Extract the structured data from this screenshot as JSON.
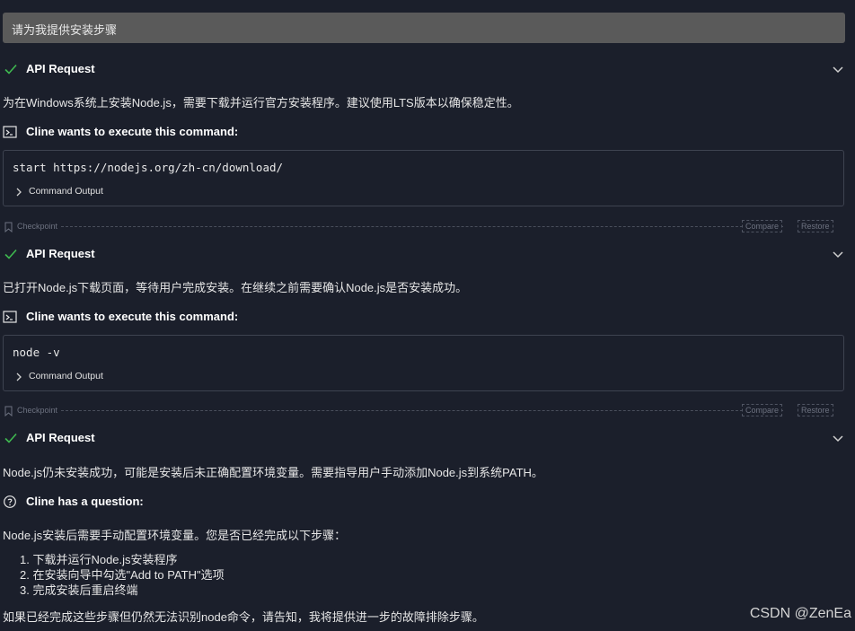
{
  "user_message": "请为我提供安装步骤",
  "api_request_title": "API Request",
  "execute_title": "Cline wants to execute this command:",
  "command_output_label": "Command Output",
  "checkpoint": {
    "label": "Checkpoint",
    "compare_label": "Compare",
    "restore_label": "Restore"
  },
  "blocks": [
    {
      "text": "为在Windows系统上安装Node.js，需要下载并运行官方安装程序。建议使用LTS版本以确保稳定性。",
      "command": "start https://nodejs.org/zh-cn/download/"
    },
    {
      "text": "已打开Node.js下载页面，等待用户完成安装。在继续之前需要确认Node.js是否安装成功。",
      "command": "node -v"
    },
    {
      "text": "Node.js仍未安装成功，可能是安装后未正确配置环境变量。需要指导用户手动添加Node.js到系统PATH。"
    }
  ],
  "question": {
    "title": "Cline has a question:",
    "intro": "Node.js安装后需要手动配置环境变量。您是否已经完成以下步骤：",
    "steps": [
      "1. 下载并运行Node.js安装程序",
      "2. 在安装向导中勾选\"Add to PATH\"选项",
      "3. 完成安装后重启终端"
    ],
    "outro": "如果已经完成这些步骤但仍然无法识别node命令，请告知，我将提供进一步的故障排除步骤。"
  },
  "watermark": "CSDN @ZenEa",
  "icons": {
    "check": "check-icon",
    "chevron": "chevron-down-icon",
    "terminal": "terminal-icon",
    "bookmark": "bookmark-icon",
    "question": "question-circle-icon"
  },
  "colors": {
    "background": "#1b1f2b",
    "user_message_bg": "#5a5a5a",
    "check": "#3fb950",
    "border": "#3e4350"
  }
}
